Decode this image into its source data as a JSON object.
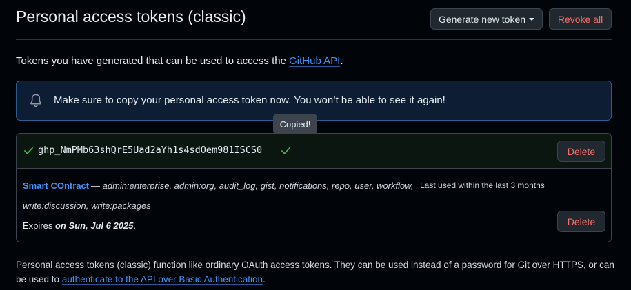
{
  "header": {
    "title": "Personal access tokens (classic)",
    "generate_label": "Generate new token",
    "revoke_label": "Revoke all"
  },
  "intro": {
    "text": "Tokens you have generated that can be used to access the ",
    "link": "GitHub API",
    "suffix": "."
  },
  "flash": {
    "text": "Make sure to copy your personal access token now. You won’t be able to see it again!"
  },
  "tooltip": {
    "text": "Copied!"
  },
  "new_token": {
    "value": "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",
    "delete_label": "Delete"
  },
  "existing_token": {
    "name": "Smart COntract",
    "scopes_line1": "— admin:enterprise, admin:org, audit_log, gist, notifications, repo, user, workflow,",
    "scopes_line2": "write:discussion, write:packages",
    "last_used": "Last used within the last 3 months",
    "expires_prefix": "Expires ",
    "expires_date": "on Sun, Jul 6 2025",
    "expires_suffix": ".",
    "delete_label": "Delete"
  },
  "footer": {
    "text": "Personal access tokens (classic) function like ordinary OAuth access tokens. They can be used instead of a password for Git over HTTPS, or can be used to ",
    "link": "authenticate to the API over Basic Authentication",
    "suffix": "."
  },
  "colors": {
    "background": "#010409",
    "link": "#4493f8",
    "danger": "#f47067",
    "success": "#3fb950",
    "flash_border": "#2f5c8f"
  },
  "icons": {
    "flash": "bell-icon",
    "token_status": "check-icon"
  }
}
